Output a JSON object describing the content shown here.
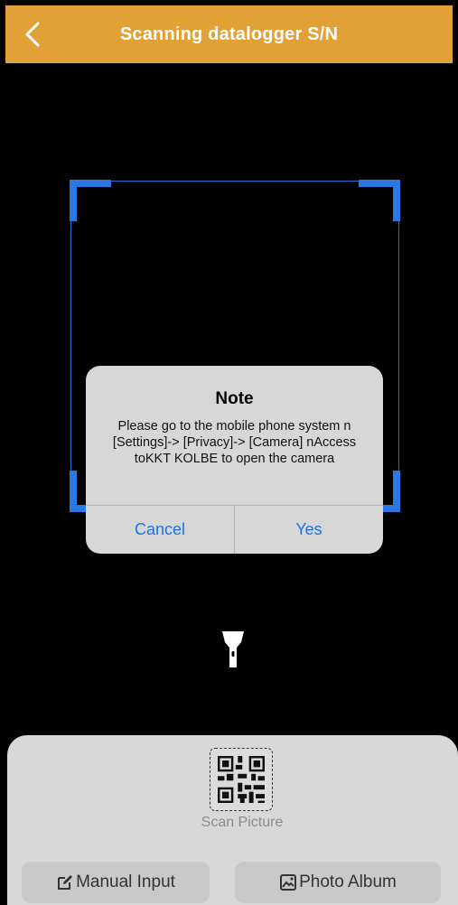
{
  "header": {
    "title": "Scanning datalogger S/N",
    "back_icon": "chevron-left-icon",
    "background": "#e2a136"
  },
  "scanner": {
    "frame_color": "#2b78e4"
  },
  "dialog": {
    "title": "Note",
    "message": "Please go to the mobile phone system n [Settings]-> [Privacy]-> [Camera] nAccess toKKT KOLBE to open the camera",
    "cancel_label": "Cancel",
    "confirm_label": "Yes",
    "button_color": "#1a73e8"
  },
  "flashlight": {
    "icon": "flashlight-icon"
  },
  "bottom_panel": {
    "scan_picture_label": "Scan Picture",
    "scan_picture_icon": "qr-code-icon",
    "manual_input_label": "Manual Input",
    "manual_input_icon": "edit-icon",
    "photo_album_label": "Photo Album",
    "photo_album_icon": "image-icon"
  }
}
